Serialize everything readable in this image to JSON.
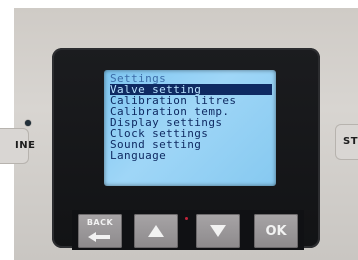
{
  "side_labels": {
    "left": "INE",
    "right": "ST"
  },
  "screen": {
    "title": "Settings",
    "items": [
      "Valve setting",
      "Calibration litres",
      "Calibration temp.",
      "Display settings",
      "Clock settings",
      "Sound setting",
      "Language"
    ],
    "selected_item": "Valve setting"
  },
  "buttons": {
    "back_label": "BACK",
    "up_icon": "up-triangle-icon",
    "down_icon": "down-triangle-icon",
    "ok_label": "OK"
  },
  "colors": {
    "lcd_background": "#8fcff4",
    "lcd_text": "#0f2a62",
    "bezel": "#16171a",
    "button": "#9a9799"
  }
}
